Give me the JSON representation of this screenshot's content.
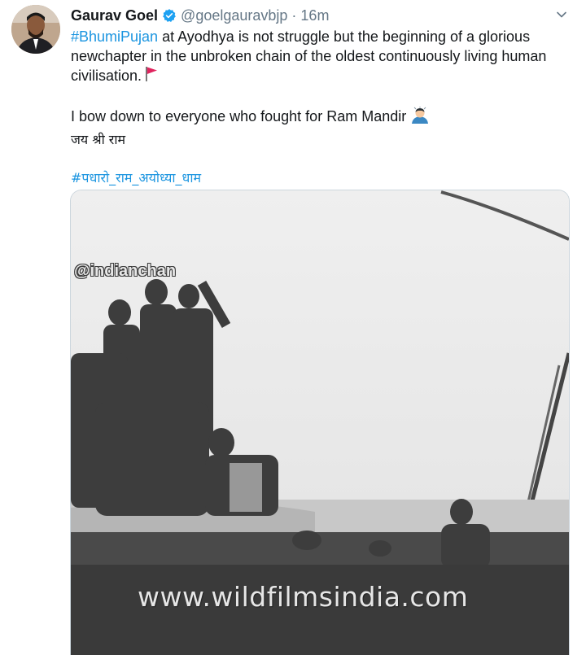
{
  "tweet": {
    "author_name": "Gaurav Goel",
    "handle": "@goelgauravbjp",
    "separator": "·",
    "time": "16m",
    "body": {
      "hashtag1": "#BhumiPujan",
      "line1_rest": " at Ayodhya is not struggle but the beginning of a glorious newchapter in the unbroken chain of the oldest continuously living human civilisation.",
      "line2": "I bow down to everyone who fought for Ram Mandir",
      "line3": "जय श्री राम",
      "hashtag2": "#पधारो_राम_अयोध्या_धाम"
    },
    "media": {
      "watermark_top": "@indianchan",
      "watermark_bottom": "www.wildfilmsindia.com"
    }
  },
  "colors": {
    "link": "#1b95e0",
    "secondary_text": "#657786",
    "verified": "#1da1f2",
    "flag": "#e0245e"
  },
  "icons": {
    "verified": "verified-badge-icon",
    "more": "chevron-down-icon",
    "flag": "triangular-flag-emoji",
    "bow": "person-bowing-emoji"
  }
}
